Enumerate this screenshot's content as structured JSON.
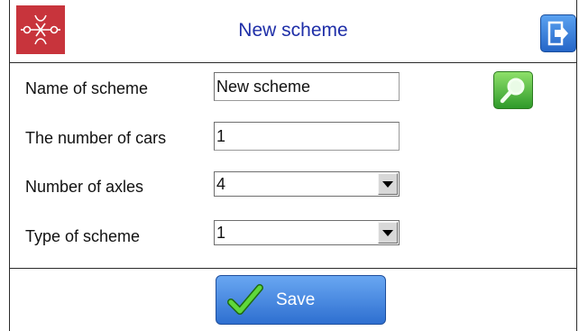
{
  "window": {
    "title": "New scheme"
  },
  "icons": {
    "logo": "scheme-logo-icon",
    "exit": "exit-icon",
    "search": "search-icon",
    "save_check": "checkmark-icon"
  },
  "colors": {
    "title": "#1f2fa8",
    "logo_bg": "#c8343c",
    "button_blue": "#2e6fd0",
    "search_green": "#2f9a2a"
  },
  "form": {
    "name_label": "Name of scheme",
    "name_value": "New scheme",
    "cars_label": "The number of cars",
    "cars_value": "1",
    "axles_label": "Number of axles",
    "axles_value": "4",
    "type_label": "Type of scheme",
    "type_value": "1"
  },
  "footer": {
    "save_label": "Save"
  }
}
